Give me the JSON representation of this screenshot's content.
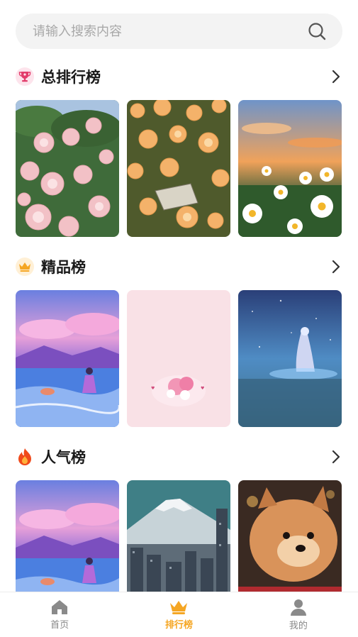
{
  "search": {
    "placeholder": "请输入搜索内容",
    "icon": "search-icon"
  },
  "sections": [
    {
      "title": "总排行榜",
      "icon": "trophy-icon",
      "icon_bg": "#fde4ec",
      "icon_color": "#e23d6b",
      "cards": [
        "pink-roses",
        "peach-roses",
        "daisies-sunset"
      ]
    },
    {
      "title": "精品榜",
      "icon": "crown-icon",
      "icon_bg": "#fff0d6",
      "icon_color": "#f5a623",
      "cards": [
        "anime-girl-beach",
        "pink-cartoon",
        "moon-mermaid"
      ]
    },
    {
      "title": "人气榜",
      "icon": "flame-icon",
      "icon_bg": "#ffffff",
      "icon_color": "#f04a1b",
      "cards": [
        "anime-girl-beach",
        "mount-fuji-city",
        "pomeranian-puppy"
      ]
    }
  ],
  "tabbar": {
    "items": [
      {
        "label": "首页",
        "icon": "home-icon",
        "active": false
      },
      {
        "label": "排行榜",
        "icon": "crown-icon",
        "active": true
      },
      {
        "label": "我的",
        "icon": "user-icon",
        "active": false
      }
    ]
  },
  "colors": {
    "accent": "#f5a623",
    "inactive": "#888888",
    "search_bg": "#f3f3f3"
  }
}
